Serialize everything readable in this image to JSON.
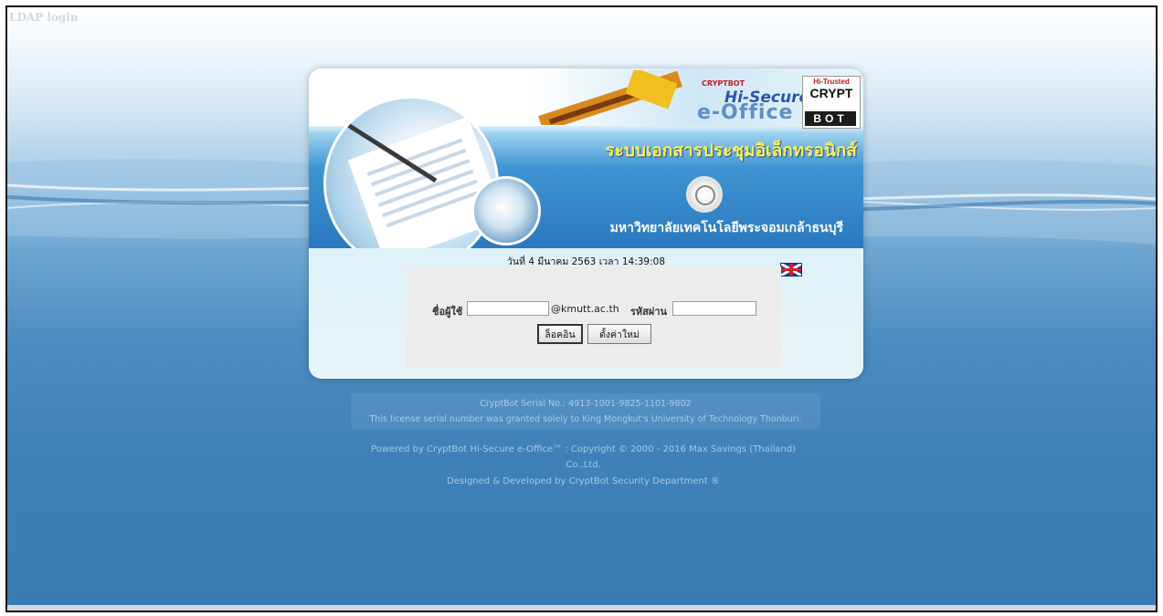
{
  "page": {
    "title": "LDAP login"
  },
  "banner": {
    "brand_small": "CRYPTBOT",
    "brand_secure": "Hi-Secure",
    "brand_eoffice": "e-Office",
    "badge_top": "Hi-Trusted",
    "badge_crypt": "CRYPT",
    "badge_bot": "BOT",
    "system_title": "ระบบเอกสารประชุมอิเล็กทรอนิกส์",
    "university": "มหาวิทยาลัยเทคโนโลยีพระจอมเกล้าธนบุรี"
  },
  "login": {
    "datetime": "วันที่ 4 มีนาคม 2563 เวลา 14:39:08",
    "language_flag": "uk-flag-icon",
    "username_label": "ชื่อผู้ใช้",
    "username_value": "",
    "domain_suffix": "@kmutt.ac.th",
    "password_label": "รหัสผ่าน",
    "password_value": "",
    "login_button": "ล็อคอิน",
    "reset_button": "ตั้งค่าใหม่"
  },
  "license": {
    "serial": "CryptBot Serial No.: 4913-1001-9825-1101-9802",
    "granted": "This license serial number was granted solely to King Mongkut's University of Technology Thonburi."
  },
  "footer": {
    "powered": "Powered by CryptBot Hi-Secure e-Office™    : Copyright © 2000 - 2016 Max Savings (Thailand)",
    "company": "Co.,Ltd.",
    "designed": "Designed & Developed by CryptBot Security Department ®"
  },
  "colors": {
    "background_bottom": "#3b7cb4",
    "title_yellow": "#ffee55",
    "footer_text": "#a6c8e3"
  }
}
